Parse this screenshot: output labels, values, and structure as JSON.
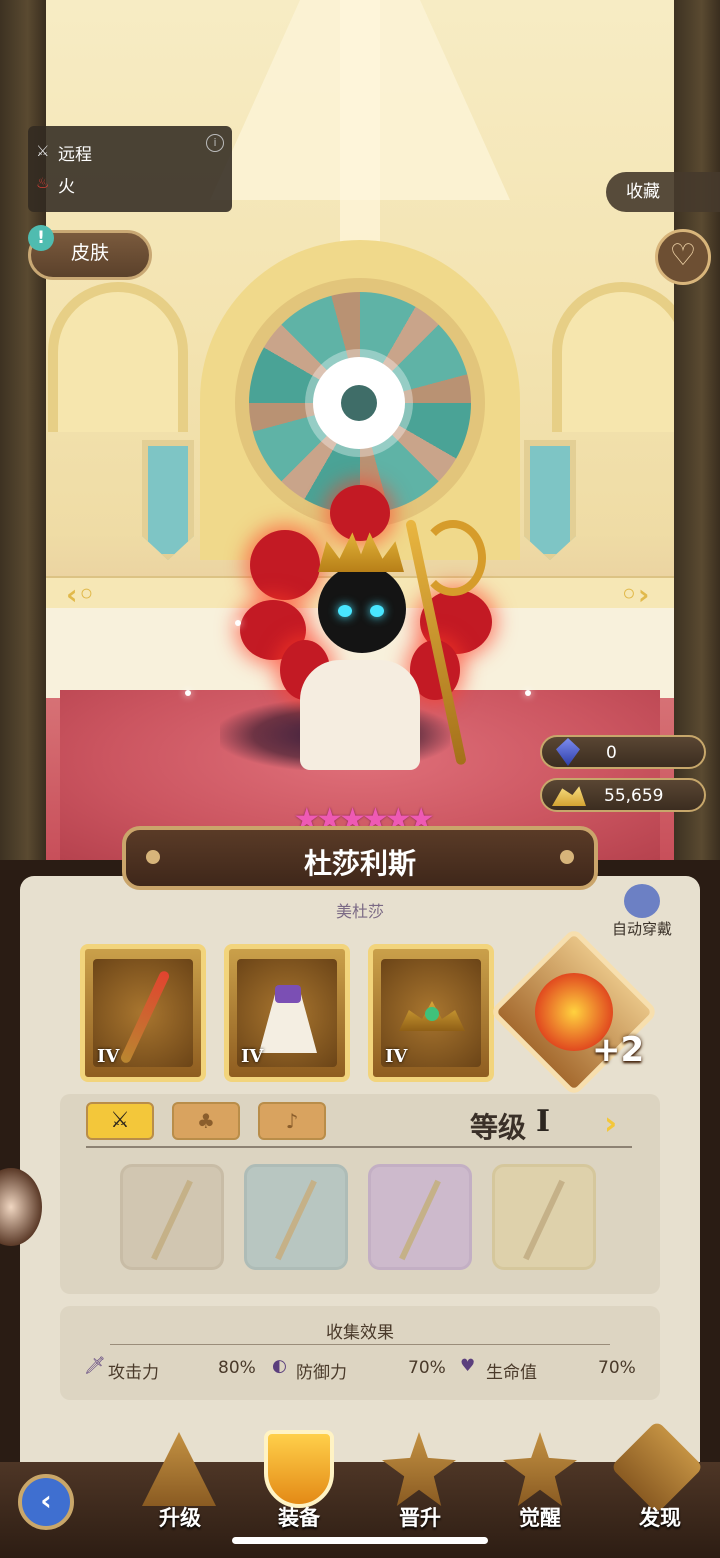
{
  "info": {
    "attack_type": "远程",
    "element": "火"
  },
  "skin_button": "皮肤",
  "collect_button": "收藏",
  "resources": [
    {
      "icon": "crystal-icon",
      "value": "0"
    },
    {
      "icon": "gold-pile-icon",
      "value": "55,659"
    }
  ],
  "hero": {
    "stars": 6,
    "star_glyphs": "★★★★★★",
    "name": "杜莎利斯",
    "subtitle": "美杜莎"
  },
  "auto_equip": "自动穿戴",
  "equipment": [
    {
      "icon": "staff-icon",
      "tier": "IV"
    },
    {
      "icon": "robe-icon",
      "tier": "IV"
    },
    {
      "icon": "crown-icon",
      "tier": "IV"
    }
  ],
  "rune": {
    "bonus": "+2"
  },
  "grade": {
    "label": "等级",
    "value": "I"
  },
  "collection": {
    "title": "收集效果",
    "stats": [
      {
        "icon": "sword-icon",
        "label": "攻击力",
        "value": "80%"
      },
      {
        "icon": "shield-icon",
        "label": "防御力",
        "value": "70%"
      },
      {
        "icon": "heart-icon",
        "label": "生命值",
        "value": "70%"
      }
    ]
  },
  "nav": [
    "升级",
    "装备",
    "晋升",
    "觉醒",
    "发现"
  ],
  "colors": {
    "accent_gold": "#f2d47c",
    "star_pink": "#ee5ab4",
    "panel": "#e7e0cf"
  }
}
